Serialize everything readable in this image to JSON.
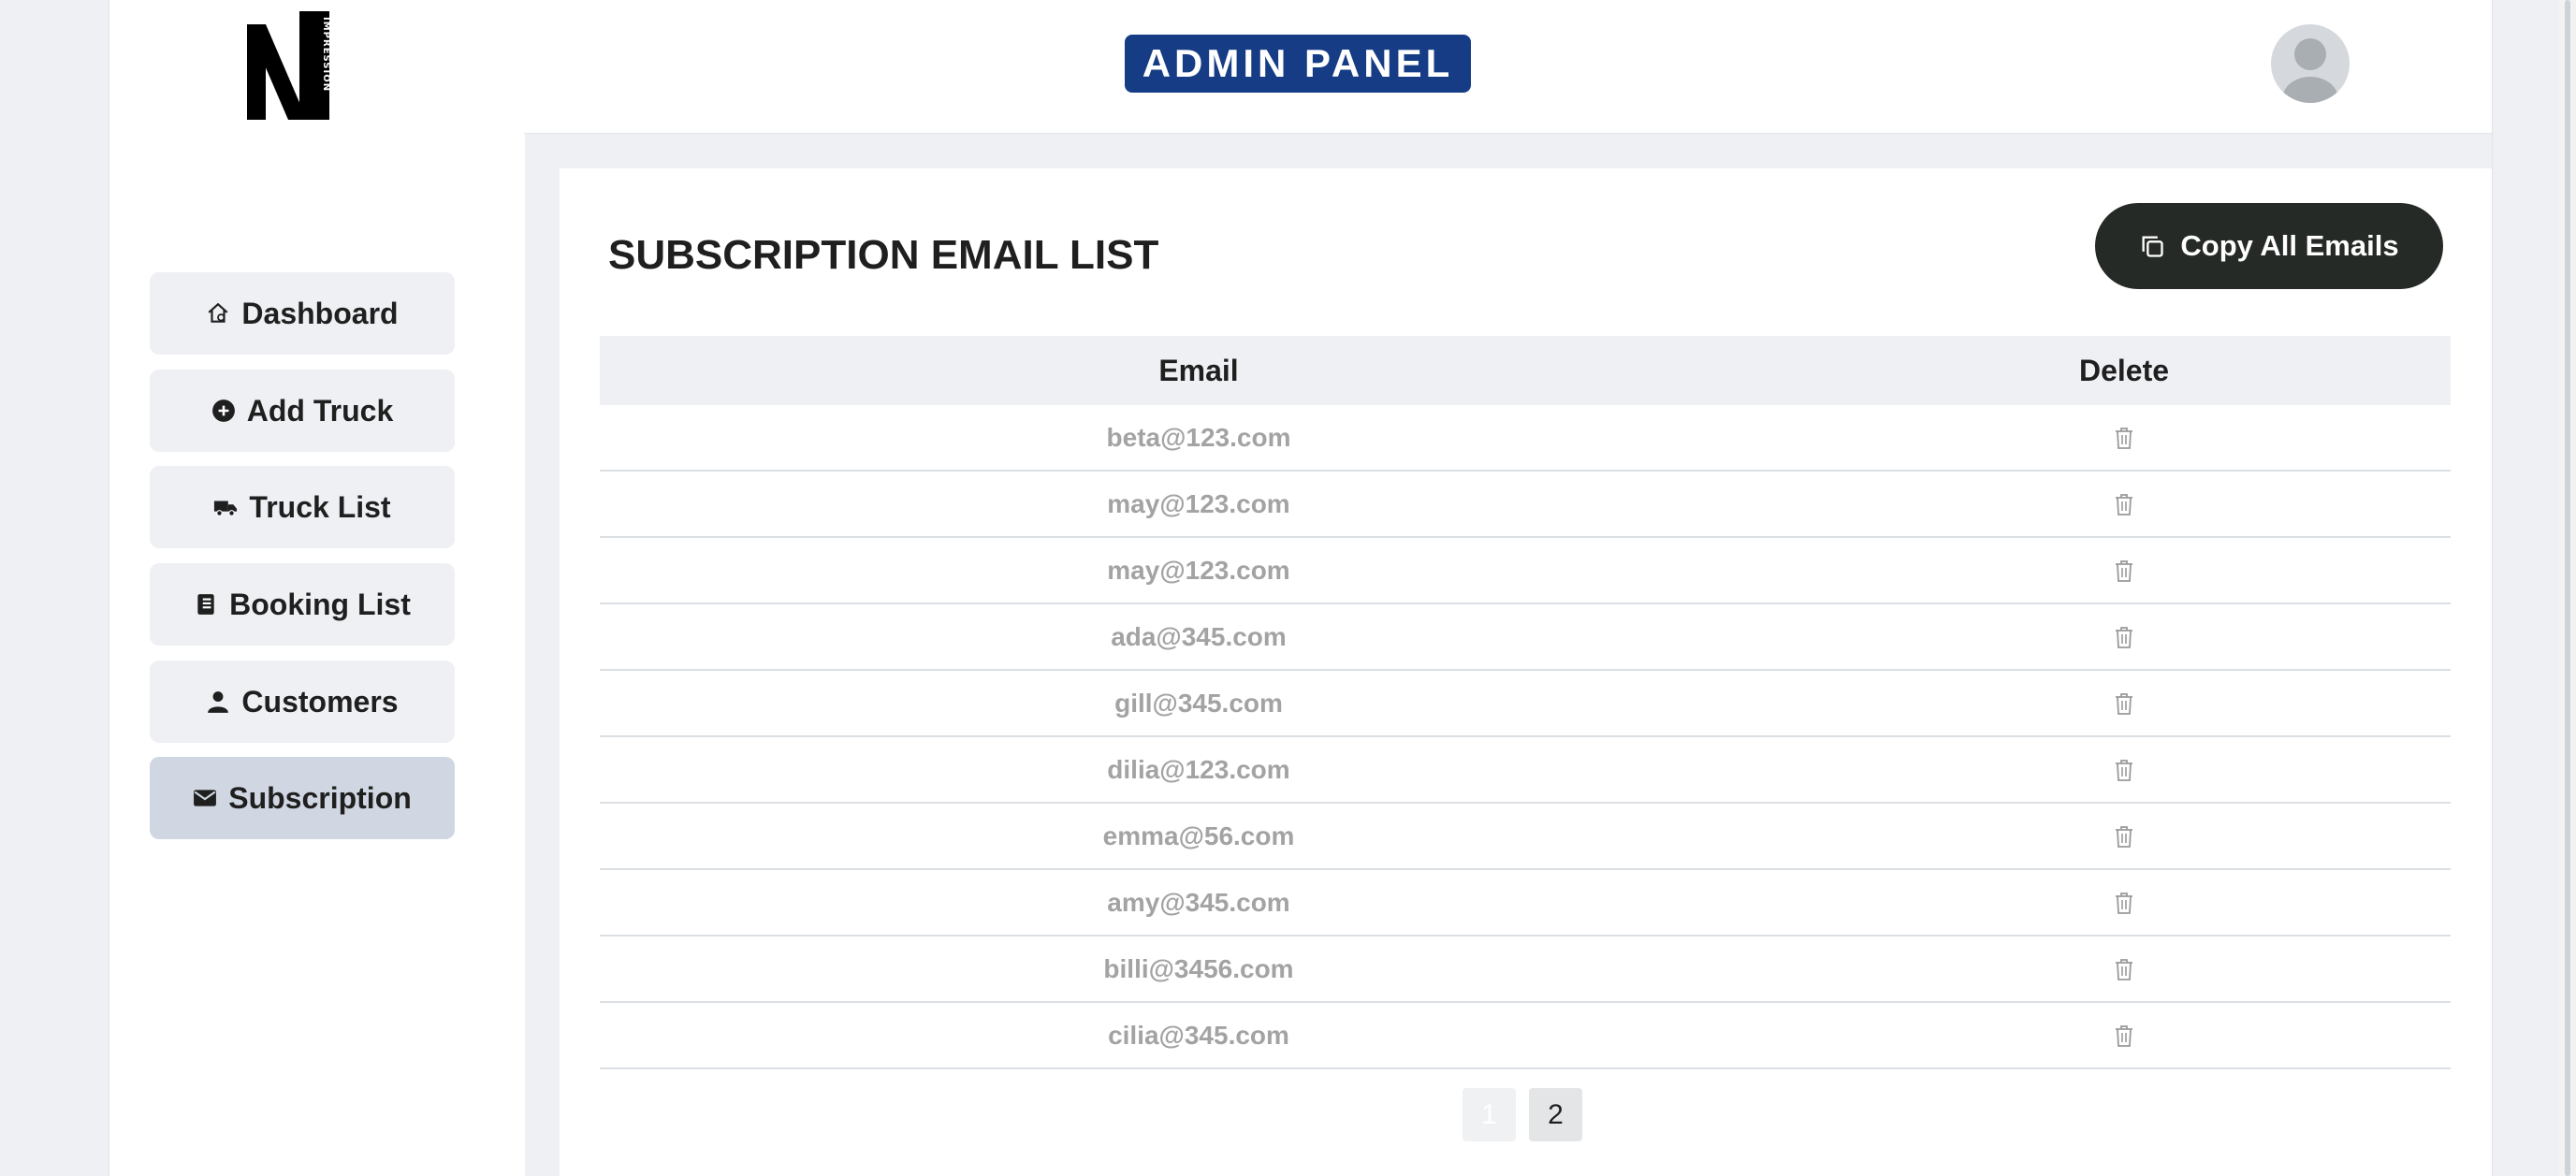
{
  "header": {
    "badge": "ADMIN PANEL",
    "logo_text": "IMPRESSION"
  },
  "sidebar": {
    "items": [
      {
        "label": "Dashboard",
        "icon": "home-icon"
      },
      {
        "label": "Add Truck",
        "icon": "add-circle-icon"
      },
      {
        "label": "Truck List",
        "icon": "truck-icon"
      },
      {
        "label": "Booking List",
        "icon": "book-icon"
      },
      {
        "label": "Customers",
        "icon": "person-icon"
      },
      {
        "label": "Subscription",
        "icon": "mail-icon",
        "active": true
      }
    ]
  },
  "main": {
    "title": "SUBSCRIPTION EMAIL LIST",
    "copy_button": "Copy All Emails",
    "table": {
      "headers": [
        "Email",
        "Delete"
      ],
      "rows": [
        "beta@123.com",
        "may@123.com",
        "may@123.com",
        "ada@345.com",
        "gill@345.com",
        "dilia@123.com",
        "emma@56.com",
        "amy@345.com",
        "billi@3456.com",
        "cilia@345.com"
      ]
    },
    "pagination": [
      "1",
      "2"
    ],
    "current_page": "1"
  },
  "colors": {
    "badge": "#163c85",
    "button": "#262a26",
    "active_nav": "#d0d7e2",
    "muted_text": "#a3a3a3"
  }
}
